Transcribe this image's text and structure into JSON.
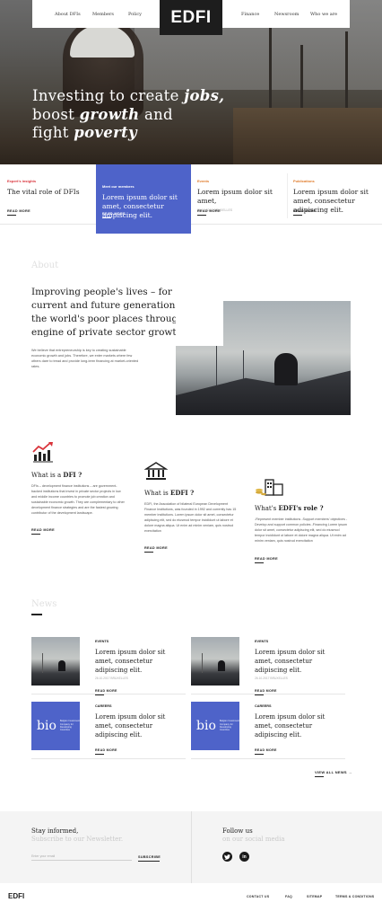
{
  "nav": {
    "left_links": [
      "About DFIs",
      "Members",
      "Policy"
    ],
    "logo": "EDFI",
    "right_links": [
      "Finance",
      "Newsroom",
      "Who we are"
    ]
  },
  "hero": {
    "line1_a": "Investing to create ",
    "line1_b": "jobs,",
    "line2_a": "boost ",
    "line2_b": "growth",
    "line2_c": " and",
    "line3_a": "fight ",
    "line3_b": "poverty"
  },
  "cards": [
    {
      "category": "Expert's insights",
      "category_color": "#d9343b",
      "title": "The vital role of DFIs",
      "meta": "",
      "more": "READ MORE"
    },
    {
      "category": "Meet our members",
      "category_color": "#ffffff",
      "title": "Lorem ipsum dolor sit amet, consectetur adipiscing elit.",
      "meta": "",
      "more": "READ MORE"
    },
    {
      "category": "Events",
      "category_color": "#e07b2a",
      "title": "Lorem ipsum dolor sit amet,",
      "meta": "26.10.2017     BRUXELLES",
      "more": "READ MORE"
    },
    {
      "category": "Publications",
      "category_color": "#e07b2a",
      "title": "Lorem ipsum dolor sit amet, consectetur adipiscing elit.",
      "meta": "",
      "more": "READ MORE"
    }
  ],
  "about": {
    "label": "About",
    "heading": "Improving people's lives – for current and future generations – in the world's poor places through the engine of private sector growth.",
    "body": "We believe that entrepreneurship is key to creating sustainable economic growth and jobs. Therefore, we enter markets where few others dare to tread and provide long-term financing at market-oriented rates."
  },
  "columns": [
    {
      "title_a": "What is a ",
      "title_b": "DFI ?",
      "body": "DFIs – development finance institutions – are government-backed institutions that invest in private sector projects in low and middle income countries to promote job creation and sustainable economic growth. They are complementary to other development finance strategies and are the fastest growing contributor of the development landscape.",
      "more": "READ MORE"
    },
    {
      "title_a": "What is ",
      "title_b": "EDFI ?",
      "body": "EDFI, the Association of bilateral European Development Finance Institutions, was founded in 1992 and currently has 15 member institutions. Lorem ipsum dolor sit amet, consectetur adipiscing elit, sed do eiusmod tempor incididunt ut labore et dolore magna aliqua. Ut enim ad minim veniam, quis nostrud exercitation",
      "more": "READ MORE"
    },
    {
      "title_a": "What's ",
      "title_b": "EDFI's role ?",
      "body": "-Represent member institutions -Support members' objectives -Develop and support common policies -Financing Lorem ipsum dolor sit amet, consectetur adipiscing elit, sed do eiusmod tempor incididunt ut labore et dolore magna aliqua. Ut enim ad minim veniam, quis nostrud exercitation",
      "more": "READ MORE"
    }
  ],
  "news": {
    "label": "News",
    "items": [
      {
        "category": "EVENTS",
        "title": "Lorem ipsum dolor sit amet, consectetur adipiscing elit.",
        "meta": "26.10.2017     BRUXELLES",
        "more": "READ MORE",
        "thumb": "photo"
      },
      {
        "category": "EVENTS",
        "title": "Lorem ipsum dolor sit amet, consectetur adipiscing elit.",
        "meta": "26.10.2017     BRUXELLES",
        "more": "READ MORE",
        "thumb": "photo"
      },
      {
        "category": "CAREERS",
        "title": "Lorem ipsum dolor sit amet, consectetur adipiscing elit.",
        "meta": "",
        "more": "READ MORE",
        "thumb": "bio"
      },
      {
        "category": "CAREERS",
        "title": "Lorem ipsum dolor sit amet, consectetur adipiscing elit.",
        "meta": "",
        "more": "READ MORE",
        "thumb": "bio"
      }
    ],
    "bio_logo": "bio",
    "bio_tagline": "Belgian Investment Company for Developing Countries",
    "view_all": "VIEW ALL NEWS →"
  },
  "newsletter": {
    "title": "Stay informed,",
    "subtitle": "Subscribe to our Newsletter.",
    "placeholder": "Enter your email",
    "button": "SUBSCRIBE"
  },
  "social": {
    "title": "Follow us",
    "subtitle": "on our social media",
    "icons": [
      "twitter-icon",
      "linkedin-icon"
    ]
  },
  "footer": {
    "logo": "EDFI",
    "links": [
      "CONTACT US",
      "FAQ",
      "SITEMAP",
      "TERMS & CONDITIONS"
    ]
  },
  "colors": {
    "accent": "#4e63c9",
    "dark": "#1d1d1d"
  }
}
